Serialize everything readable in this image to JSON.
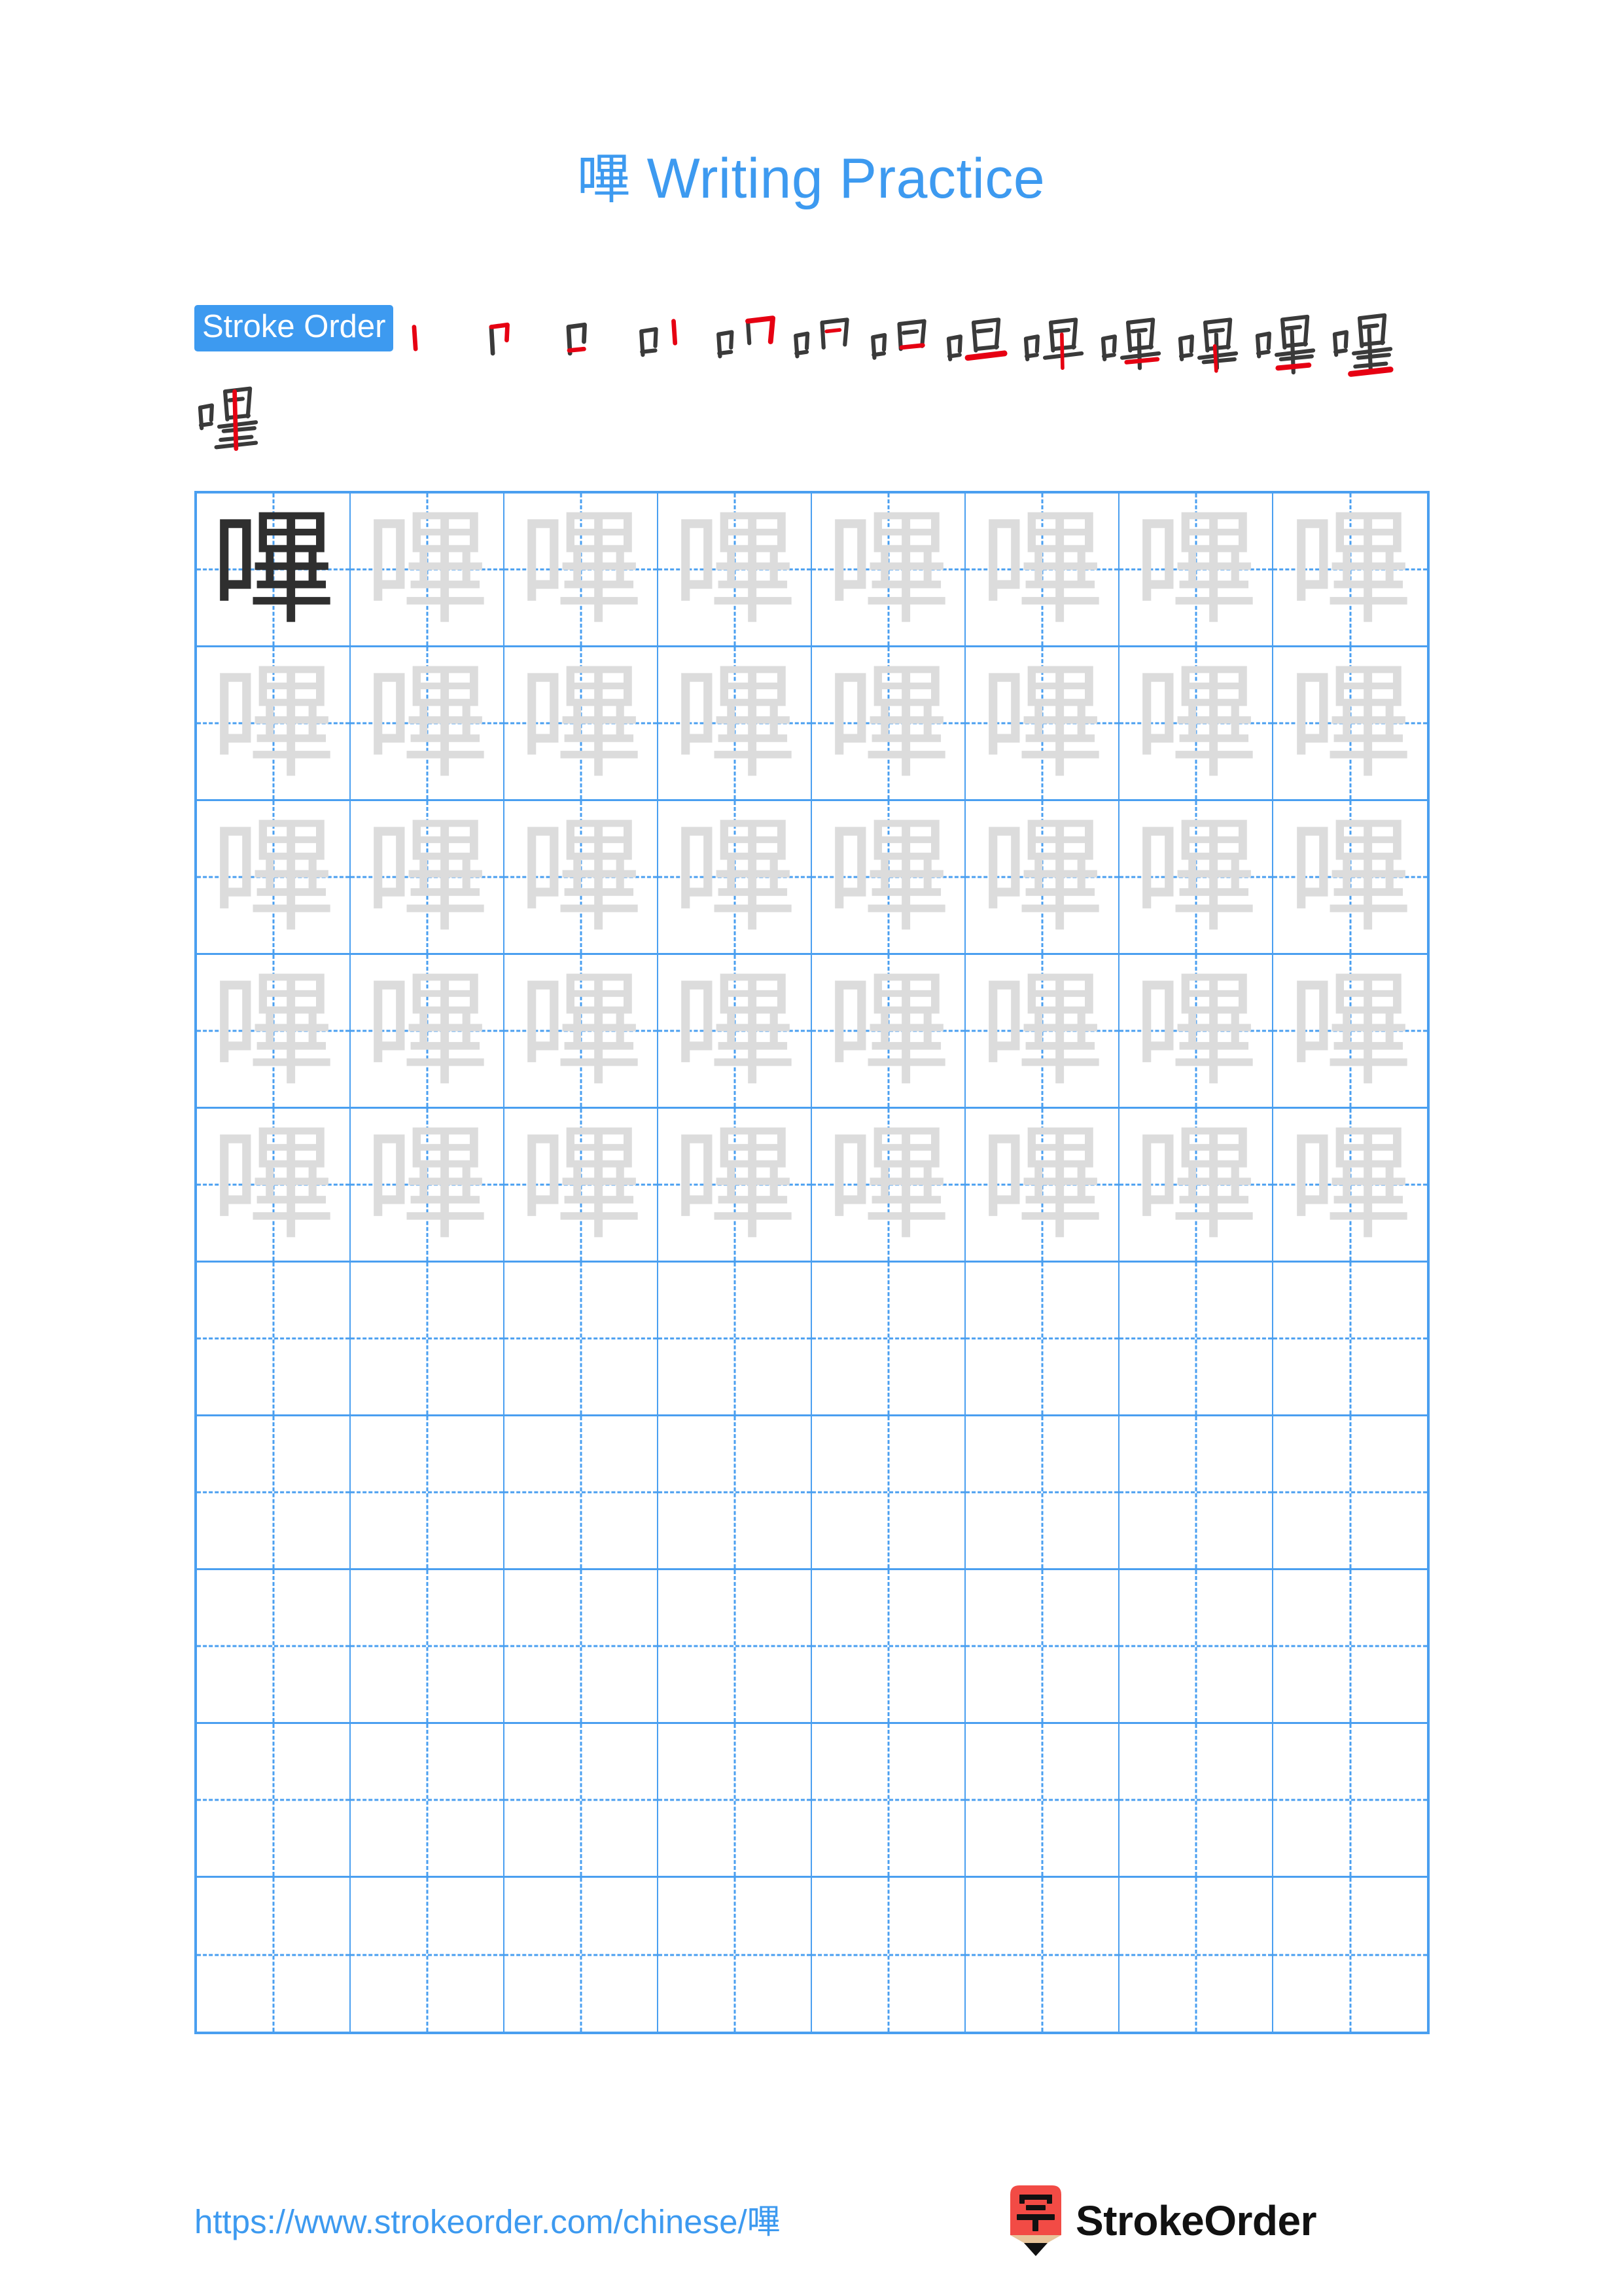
{
  "character": "嗶",
  "header": {
    "title_character": "嗶",
    "title_text": "Writing Practice"
  },
  "stroke_order": {
    "badge_label": "Stroke Order",
    "total_strokes": 14,
    "steps": [
      {
        "index": 1,
        "partial": "丨"
      },
      {
        "index": 2,
        "partial": "冂"
      },
      {
        "index": 3,
        "partial": "口"
      },
      {
        "index": 4,
        "partial": "口丨"
      },
      {
        "index": 5,
        "partial": "口冂"
      },
      {
        "index": 6,
        "partial": "口冂一"
      },
      {
        "index": 7,
        "partial": "口曰"
      },
      {
        "index": 8,
        "partial": "口日一"
      },
      {
        "index": 9,
        "partial": "口甲"
      },
      {
        "index": 10,
        "partial": "口甲丨"
      },
      {
        "index": 11,
        "partial": "口畢上"
      },
      {
        "index": 12,
        "partial": "口畢中"
      },
      {
        "index": 13,
        "partial": "口畢下"
      },
      {
        "index": 14,
        "partial": "嗶"
      }
    ]
  },
  "practice_grid": {
    "columns": 8,
    "rows": 10,
    "filled_rows": 5,
    "model_cell_index": 0,
    "glyph": "嗶"
  },
  "footer": {
    "url": "https://www.strokeorder.com/chinese/嗶",
    "brand_name": "StrokeOrder",
    "brand_logo_character": "字"
  },
  "colors": {
    "accent_blue": "#3d9af0",
    "grid_blue": "#4a9ff0",
    "model_ink": "#2f2f2f",
    "trace_ink": "#dcdcdc",
    "highlight_red": "#e60012",
    "logo_red": "#f24b45"
  }
}
